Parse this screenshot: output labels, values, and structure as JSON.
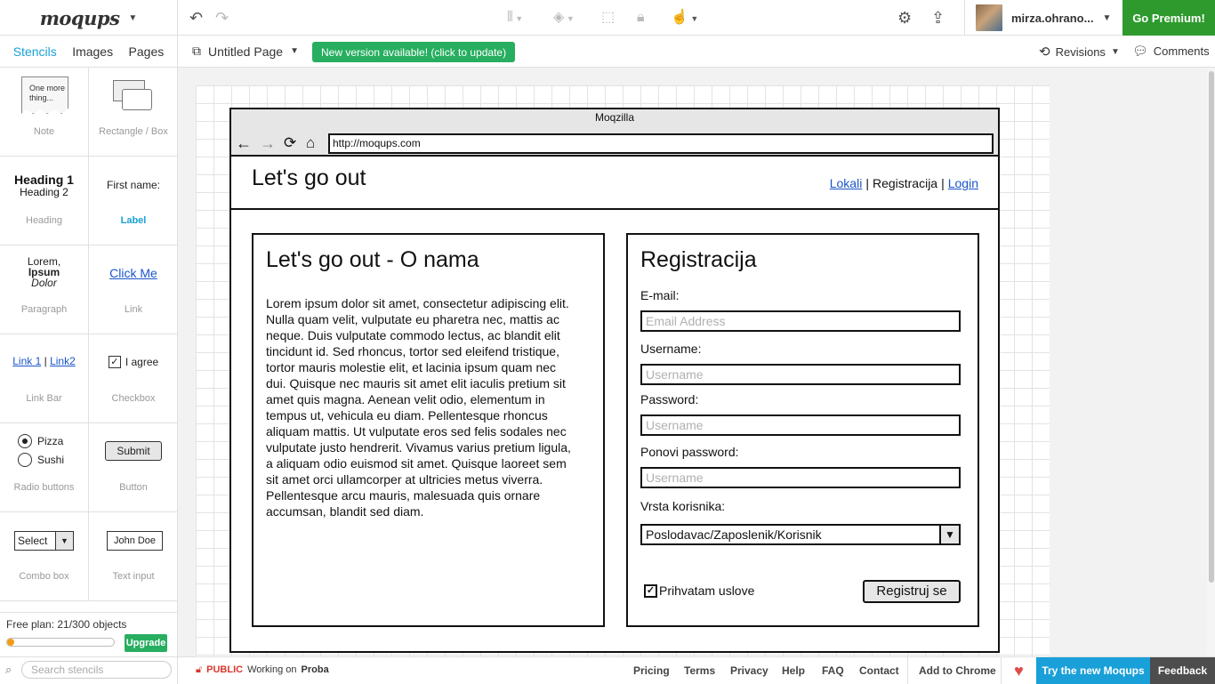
{
  "app": {
    "logo": "moqups",
    "user": "mirza.ohrano...",
    "premium": "Go Premium!",
    "colors": {
      "accent": "#1aa0d8",
      "green": "#27ae60",
      "premium": "#2e9a2e",
      "feedback": "#4d4d4d"
    }
  },
  "toolbar": {
    "icons": [
      "undo-icon",
      "redo-icon",
      "align-icon",
      "layers-icon",
      "frame-icon",
      "lock-icon",
      "interaction-icon",
      "gear-icon",
      "share-icon"
    ]
  },
  "tabs": [
    "Stencils",
    "Images",
    "Pages"
  ],
  "page": {
    "name": "Untitled Page",
    "update_notice": "New version available! (click to update)"
  },
  "right_tools": {
    "revisions": "Revisions",
    "comments": "Comments"
  },
  "stencils": [
    {
      "label": "Note",
      "preview": "One more thing..."
    },
    {
      "label": "Rectangle / Box",
      "preview": ""
    },
    {
      "label": "Heading",
      "preview1": "Heading 1",
      "preview2": "Heading 2"
    },
    {
      "label": "Label",
      "preview": "First name:"
    },
    {
      "label": "Paragraph",
      "preview1": "Lorem,",
      "preview2": "Ipsum",
      "preview3": "Dolor"
    },
    {
      "label": "Link",
      "preview": "Click Me"
    },
    {
      "label": "Link Bar",
      "preview1": "Link 1",
      "preview2": "Link2"
    },
    {
      "label": "Checkbox",
      "preview": "I agree"
    },
    {
      "label": "Radio buttons",
      "preview1": "Pizza",
      "preview2": "Sushi"
    },
    {
      "label": "Button",
      "preview": "Submit"
    },
    {
      "label": "Combo box",
      "preview": "Select"
    },
    {
      "label": "Text input",
      "preview": "John Doe"
    }
  ],
  "plan": {
    "text": "Free plan: 21/300 objects",
    "used": 21,
    "total": 300,
    "upgrade": "Upgrade"
  },
  "mockup": {
    "window_title": "Moqzilla",
    "url": "http://moqups.com",
    "site_title": "Let's go out",
    "nav": [
      "Lokali",
      "Registracija",
      "Login"
    ],
    "about": {
      "heading": "Let's go out - O nama",
      "body": "Lorem ipsum dolor sit amet, consectetur adipiscing elit. Nulla quam velit, vulputate eu pharetra nec, mattis ac neque. Duis vulputate commodo lectus, ac blandit elit tincidunt id. Sed rhoncus, tortor sed eleifend tristique, tortor mauris molestie elit, et lacinia ipsum quam nec dui. Quisque nec mauris sit amet elit iaculis pretium sit amet quis magna. Aenean velit odio, elementum in tempus ut, vehicula eu diam. Pellentesque rhoncus aliquam mattis. Ut vulputate eros sed felis sodales nec vulputate justo hendrerit. Vivamus varius pretium ligula, a aliquam odio euismod sit amet. Quisque laoreet sem sit amet orci ullamcorper at ultricies metus viverra. Pellentesque arcu mauris, malesuada quis ornare accumsan, blandit sed diam."
    },
    "register": {
      "heading": "Registracija",
      "email_label": "E-mail:",
      "email_placeholder": "Email Address",
      "username_label": "Username:",
      "username_placeholder": "Username",
      "password_label": "Password:",
      "password_placeholder": "Username",
      "repeat_label": "Ponovi password:",
      "repeat_placeholder": "Username",
      "type_label": "Vrsta korisnika:",
      "type_value": "Poslodavac/Zaposlenik/Korisnik",
      "agree": "Prihvatam uslove",
      "submit": "Registruj se"
    }
  },
  "footer": {
    "search_placeholder": "Search stencils",
    "public": "PUBLIC",
    "working_on": "Working on",
    "project": "Proba",
    "links": [
      "Pricing",
      "Terms",
      "Privacy",
      "Help",
      "FAQ",
      "Contact",
      "Add to Chrome"
    ],
    "try_new": "Try the new Moqups",
    "feedback": "Feedback"
  }
}
